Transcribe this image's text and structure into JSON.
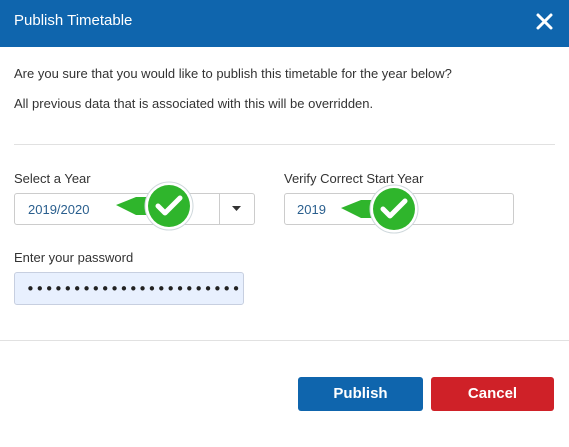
{
  "dialog": {
    "title": "Publish Timetable",
    "message_line1": "Are you sure that you would like to publish this timetable for the year below?",
    "message_line2": "All previous data that is associated with this will be overridden."
  },
  "form": {
    "year": {
      "label": "Select a Year",
      "value": "2019/2020"
    },
    "start_year": {
      "label": "Verify Correct Start Year",
      "value": "2019"
    },
    "password": {
      "label": "Enter your password",
      "masked_value": "•••••••••••••••••••••••"
    }
  },
  "buttons": {
    "publish": "Publish",
    "cancel": "Cancel"
  },
  "icons": {
    "close": "close-icon",
    "dropdown": "chevron-down-icon",
    "checkmark": "checkmark-icon"
  },
  "colors": {
    "header": "#0f65ad",
    "publish": "#0f65ad",
    "cancel": "#cf2128",
    "checkmark_badge": "#2fb52c"
  }
}
